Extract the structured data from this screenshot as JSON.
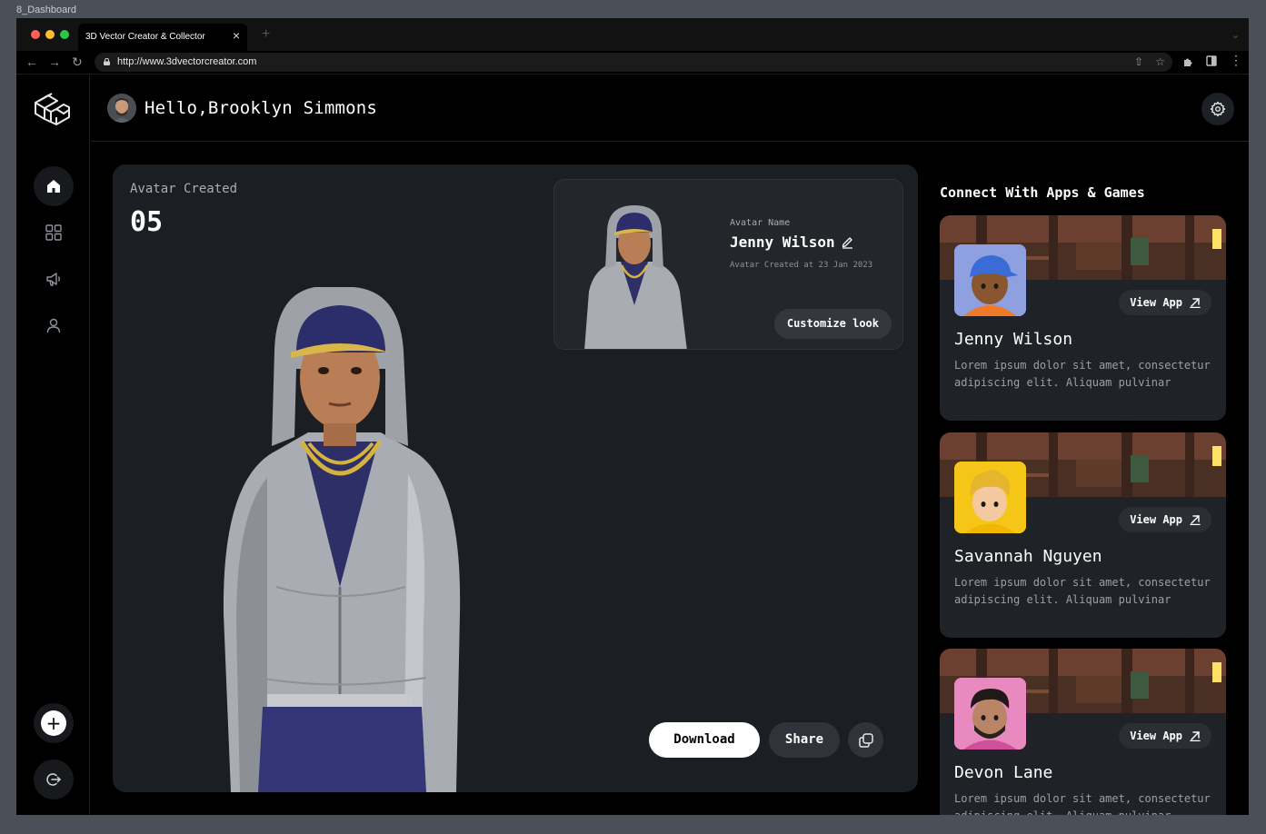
{
  "frame_label": "8_Dashboard",
  "browser": {
    "tab_title": "3D Vector Creator & Collector",
    "url": "http://www.3dvectorcreator.com"
  },
  "header": {
    "greeting": "Hello,Brooklyn Simmons"
  },
  "sidebar": {
    "items": [
      {
        "name": "home",
        "icon": "home-icon",
        "active": true
      },
      {
        "name": "grid",
        "icon": "grid-icon",
        "active": false
      },
      {
        "name": "campaign",
        "icon": "megaphone-icon",
        "active": false
      },
      {
        "name": "profile",
        "icon": "user-icon",
        "active": false
      }
    ]
  },
  "main": {
    "avatar_created_label": "Avatar Created",
    "avatar_created_count": "05",
    "info_card": {
      "name_label": "Avatar Name",
      "name": "Jenny Wilson",
      "created_at": "Avatar Created at 23 Jan 2023",
      "customize_label": "Customize look"
    },
    "download_label": "Download",
    "share_label": "Share"
  },
  "apps": {
    "title": "Connect With Apps & Games",
    "view_label": "View App",
    "items": [
      {
        "name": "Jenny Wilson",
        "desc": "Lorem ipsum dolor sit amet, consectetur adipiscing elit. Aliquam pulvinar",
        "avatar_bg": "#7b8fd6"
      },
      {
        "name": "Savannah Nguyen",
        "desc": "Lorem ipsum dolor sit amet, consectetur adipiscing elit. Aliquam pulvinar",
        "avatar_bg": "#f5c518"
      },
      {
        "name": "Devon Lane",
        "desc": "Lorem ipsum dolor sit amet, consectetur adipiscing elit. Aliquam pulvinar",
        "avatar_bg": "#e87ab4"
      }
    ]
  },
  "colors": {
    "background": "#000000",
    "card": "#1b1e22",
    "accent": "#ffffff"
  }
}
